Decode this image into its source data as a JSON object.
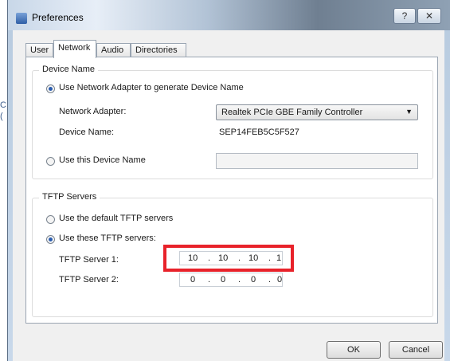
{
  "window": {
    "title": "Preferences",
    "help_symbol": "?",
    "close_symbol": "✕"
  },
  "background": {
    "mark1": "C",
    "mark2": "("
  },
  "tabs": [
    "User",
    "Network",
    "Audio",
    "Directories"
  ],
  "active_tab": "Network",
  "device_name_group": {
    "label": "Device Name",
    "use_adapter_option": "Use Network Adapter to generate Device Name",
    "network_adapter_label": "Network Adapter:",
    "network_adapter_value": "Realtek PCIe GBE Family Controller",
    "device_name_label": "Device Name:",
    "device_name_value": "SEP14FEB5C5F527",
    "use_this_option": "Use this Device Name",
    "custom_name_value": ""
  },
  "tftp_group": {
    "label": "TFTP Servers",
    "default_option": "Use the default TFTP servers",
    "these_option": "Use these TFTP servers:",
    "server1_label": "TFTP Server 1:",
    "server1_octets": [
      "10",
      "10",
      "10",
      "1"
    ],
    "server2_label": "TFTP Server 2:",
    "server2_octets": [
      "0",
      "0",
      "0",
      "0"
    ],
    "separator": "."
  },
  "buttons": {
    "ok": "OK",
    "cancel": "Cancel"
  },
  "colors": {
    "highlight": "#e8222a",
    "radio_selected": "#2a5db0"
  },
  "icons": {
    "app": "preferences-app-icon",
    "dropdown": "chevron-down-icon"
  }
}
